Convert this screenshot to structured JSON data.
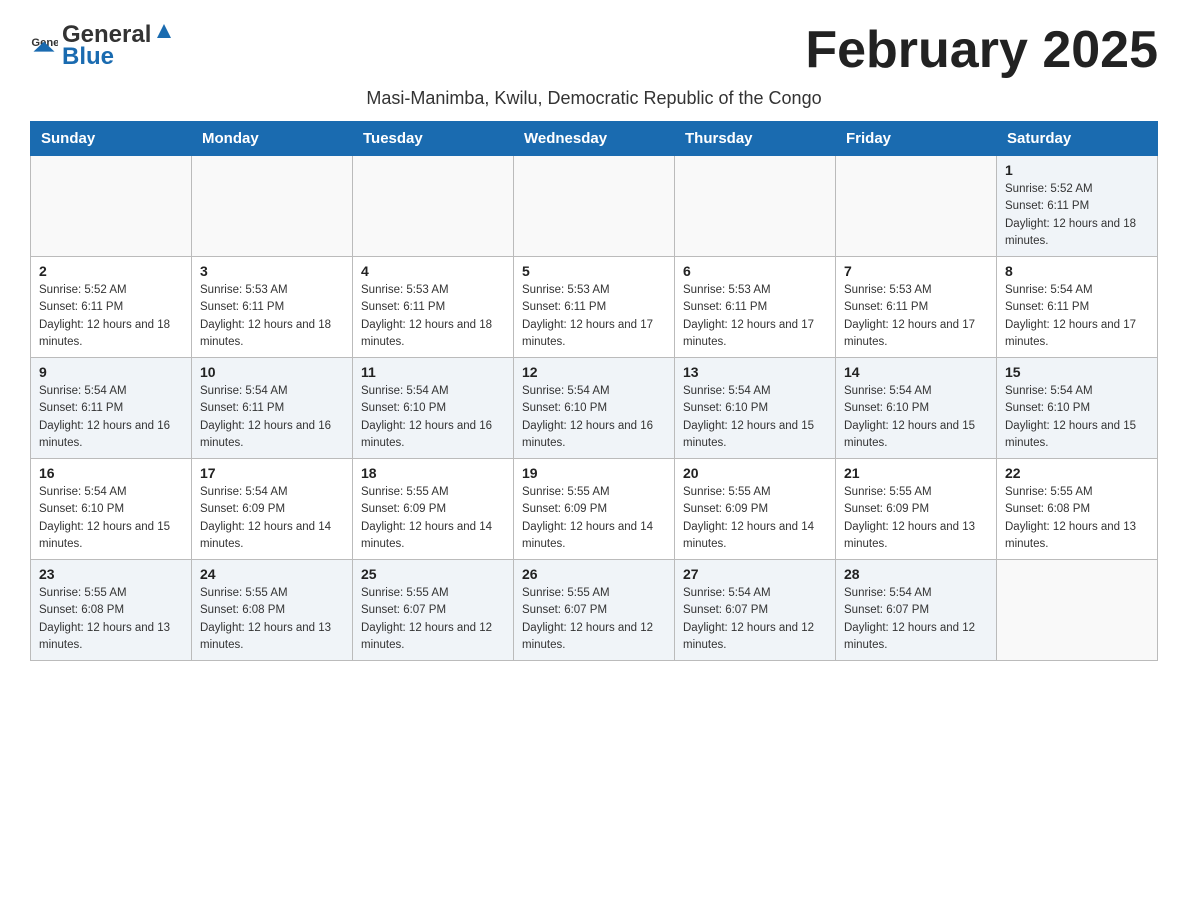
{
  "header": {
    "logo_general": "General",
    "logo_blue": "Blue",
    "month_title": "February 2025"
  },
  "subtitle": "Masi-Manimba, Kwilu, Democratic Republic of the Congo",
  "weekdays": [
    "Sunday",
    "Monday",
    "Tuesday",
    "Wednesday",
    "Thursday",
    "Friday",
    "Saturday"
  ],
  "rows": [
    {
      "cells": [
        {
          "day": "",
          "sunrise": "",
          "sunset": "",
          "daylight": ""
        },
        {
          "day": "",
          "sunrise": "",
          "sunset": "",
          "daylight": ""
        },
        {
          "day": "",
          "sunrise": "",
          "sunset": "",
          "daylight": ""
        },
        {
          "day": "",
          "sunrise": "",
          "sunset": "",
          "daylight": ""
        },
        {
          "day": "",
          "sunrise": "",
          "sunset": "",
          "daylight": ""
        },
        {
          "day": "",
          "sunrise": "",
          "sunset": "",
          "daylight": ""
        },
        {
          "day": "1",
          "sunrise": "Sunrise: 5:52 AM",
          "sunset": "Sunset: 6:11 PM",
          "daylight": "Daylight: 12 hours and 18 minutes."
        }
      ]
    },
    {
      "cells": [
        {
          "day": "2",
          "sunrise": "Sunrise: 5:52 AM",
          "sunset": "Sunset: 6:11 PM",
          "daylight": "Daylight: 12 hours and 18 minutes."
        },
        {
          "day": "3",
          "sunrise": "Sunrise: 5:53 AM",
          "sunset": "Sunset: 6:11 PM",
          "daylight": "Daylight: 12 hours and 18 minutes."
        },
        {
          "day": "4",
          "sunrise": "Sunrise: 5:53 AM",
          "sunset": "Sunset: 6:11 PM",
          "daylight": "Daylight: 12 hours and 18 minutes."
        },
        {
          "day": "5",
          "sunrise": "Sunrise: 5:53 AM",
          "sunset": "Sunset: 6:11 PM",
          "daylight": "Daylight: 12 hours and 17 minutes."
        },
        {
          "day": "6",
          "sunrise": "Sunrise: 5:53 AM",
          "sunset": "Sunset: 6:11 PM",
          "daylight": "Daylight: 12 hours and 17 minutes."
        },
        {
          "day": "7",
          "sunrise": "Sunrise: 5:53 AM",
          "sunset": "Sunset: 6:11 PM",
          "daylight": "Daylight: 12 hours and 17 minutes."
        },
        {
          "day": "8",
          "sunrise": "Sunrise: 5:54 AM",
          "sunset": "Sunset: 6:11 PM",
          "daylight": "Daylight: 12 hours and 17 minutes."
        }
      ]
    },
    {
      "cells": [
        {
          "day": "9",
          "sunrise": "Sunrise: 5:54 AM",
          "sunset": "Sunset: 6:11 PM",
          "daylight": "Daylight: 12 hours and 16 minutes."
        },
        {
          "day": "10",
          "sunrise": "Sunrise: 5:54 AM",
          "sunset": "Sunset: 6:11 PM",
          "daylight": "Daylight: 12 hours and 16 minutes."
        },
        {
          "day": "11",
          "sunrise": "Sunrise: 5:54 AM",
          "sunset": "Sunset: 6:10 PM",
          "daylight": "Daylight: 12 hours and 16 minutes."
        },
        {
          "day": "12",
          "sunrise": "Sunrise: 5:54 AM",
          "sunset": "Sunset: 6:10 PM",
          "daylight": "Daylight: 12 hours and 16 minutes."
        },
        {
          "day": "13",
          "sunrise": "Sunrise: 5:54 AM",
          "sunset": "Sunset: 6:10 PM",
          "daylight": "Daylight: 12 hours and 15 minutes."
        },
        {
          "day": "14",
          "sunrise": "Sunrise: 5:54 AM",
          "sunset": "Sunset: 6:10 PM",
          "daylight": "Daylight: 12 hours and 15 minutes."
        },
        {
          "day": "15",
          "sunrise": "Sunrise: 5:54 AM",
          "sunset": "Sunset: 6:10 PM",
          "daylight": "Daylight: 12 hours and 15 minutes."
        }
      ]
    },
    {
      "cells": [
        {
          "day": "16",
          "sunrise": "Sunrise: 5:54 AM",
          "sunset": "Sunset: 6:10 PM",
          "daylight": "Daylight: 12 hours and 15 minutes."
        },
        {
          "day": "17",
          "sunrise": "Sunrise: 5:54 AM",
          "sunset": "Sunset: 6:09 PM",
          "daylight": "Daylight: 12 hours and 14 minutes."
        },
        {
          "day": "18",
          "sunrise": "Sunrise: 5:55 AM",
          "sunset": "Sunset: 6:09 PM",
          "daylight": "Daylight: 12 hours and 14 minutes."
        },
        {
          "day": "19",
          "sunrise": "Sunrise: 5:55 AM",
          "sunset": "Sunset: 6:09 PM",
          "daylight": "Daylight: 12 hours and 14 minutes."
        },
        {
          "day": "20",
          "sunrise": "Sunrise: 5:55 AM",
          "sunset": "Sunset: 6:09 PM",
          "daylight": "Daylight: 12 hours and 14 minutes."
        },
        {
          "day": "21",
          "sunrise": "Sunrise: 5:55 AM",
          "sunset": "Sunset: 6:09 PM",
          "daylight": "Daylight: 12 hours and 13 minutes."
        },
        {
          "day": "22",
          "sunrise": "Sunrise: 5:55 AM",
          "sunset": "Sunset: 6:08 PM",
          "daylight": "Daylight: 12 hours and 13 minutes."
        }
      ]
    },
    {
      "cells": [
        {
          "day": "23",
          "sunrise": "Sunrise: 5:55 AM",
          "sunset": "Sunset: 6:08 PM",
          "daylight": "Daylight: 12 hours and 13 minutes."
        },
        {
          "day": "24",
          "sunrise": "Sunrise: 5:55 AM",
          "sunset": "Sunset: 6:08 PM",
          "daylight": "Daylight: 12 hours and 13 minutes."
        },
        {
          "day": "25",
          "sunrise": "Sunrise: 5:55 AM",
          "sunset": "Sunset: 6:07 PM",
          "daylight": "Daylight: 12 hours and 12 minutes."
        },
        {
          "day": "26",
          "sunrise": "Sunrise: 5:55 AM",
          "sunset": "Sunset: 6:07 PM",
          "daylight": "Daylight: 12 hours and 12 minutes."
        },
        {
          "day": "27",
          "sunrise": "Sunrise: 5:54 AM",
          "sunset": "Sunset: 6:07 PM",
          "daylight": "Daylight: 12 hours and 12 minutes."
        },
        {
          "day": "28",
          "sunrise": "Sunrise: 5:54 AM",
          "sunset": "Sunset: 6:07 PM",
          "daylight": "Daylight: 12 hours and 12 minutes."
        },
        {
          "day": "",
          "sunrise": "",
          "sunset": "",
          "daylight": ""
        }
      ]
    }
  ]
}
